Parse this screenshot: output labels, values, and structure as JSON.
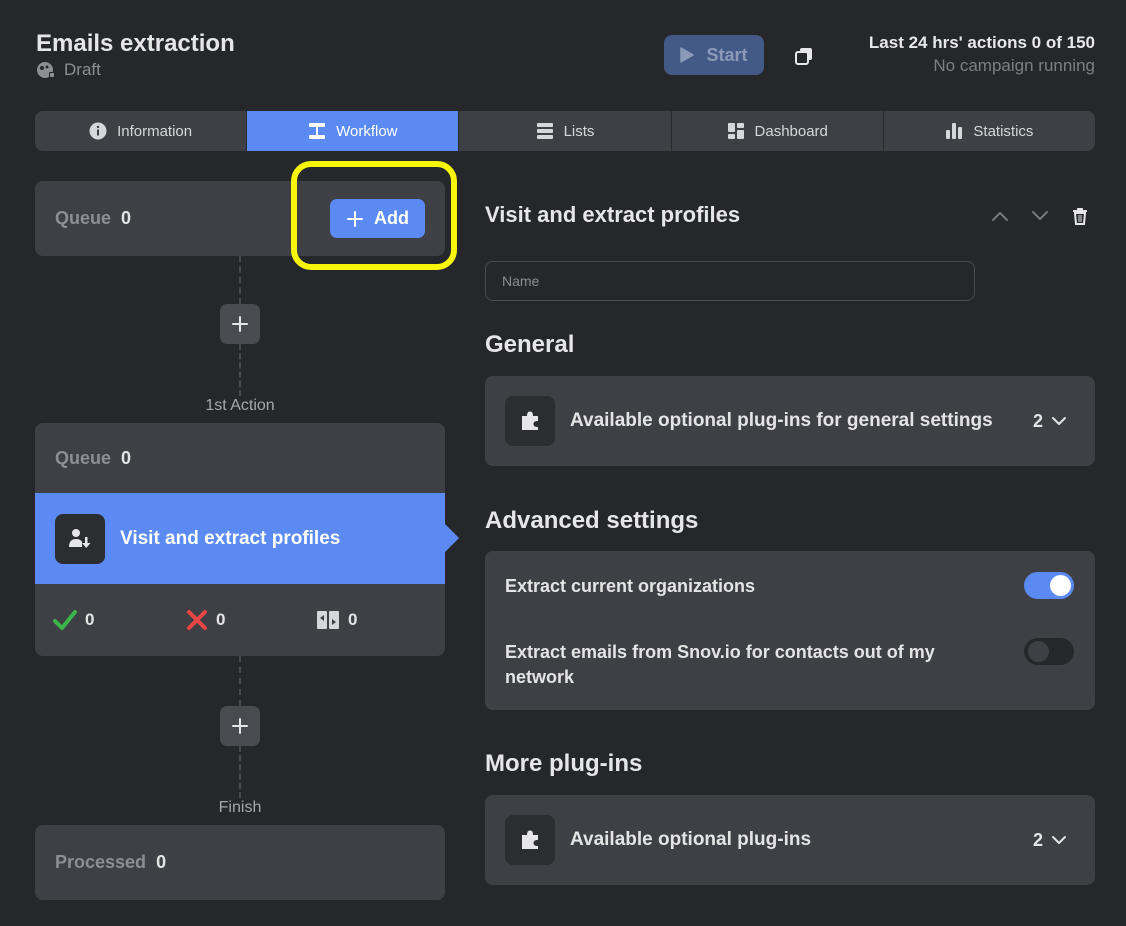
{
  "header": {
    "title": "Emails extraction",
    "status": "Draft",
    "start_label": "Start",
    "quota_line": "Last 24 hrs' actions 0 of 150",
    "campaign_status": "No campaign running"
  },
  "tabs": [
    {
      "label": "Information",
      "icon": "info-icon"
    },
    {
      "label": "Workflow",
      "icon": "workflow-icon",
      "active": true
    },
    {
      "label": "Lists",
      "icon": "list-icon"
    },
    {
      "label": "Dashboard",
      "icon": "dashboard-icon"
    },
    {
      "label": "Statistics",
      "icon": "bar-chart-icon"
    }
  ],
  "workflow": {
    "queue_label": "Queue",
    "queue_count": "0",
    "add_label": "Add",
    "first_action_label": "1st Action",
    "action": {
      "queue_label": "Queue",
      "queue_count": "0",
      "title": "Visit and extract profiles",
      "success_count": "0",
      "failed_count": "0",
      "skipped_count": "0"
    },
    "finish_label": "Finish",
    "processed_label": "Processed",
    "processed_count": "0"
  },
  "panel": {
    "title": "Visit and extract profiles",
    "name_placeholder": "Name",
    "general_heading": "General",
    "general_plugins_label": "Available optional plug-ins for general settings",
    "general_plugins_count": "2",
    "advanced_heading": "Advanced settings",
    "extract_orgs_label": "Extract current organizations",
    "extract_orgs_enabled": true,
    "extract_emails_label": "Extract emails from Snov.io for contacts out of my network",
    "extract_emails_enabled": false,
    "more_heading": "More plug-ins",
    "more_plugins_label": "Available optional plug-ins",
    "more_plugins_count": "2"
  },
  "colors": {
    "accent": "#5a8af2",
    "background": "#26272b",
    "card": "#3f4046",
    "highlight": "#f7f50a",
    "success": "#3ab54a",
    "error": "#e84545"
  }
}
